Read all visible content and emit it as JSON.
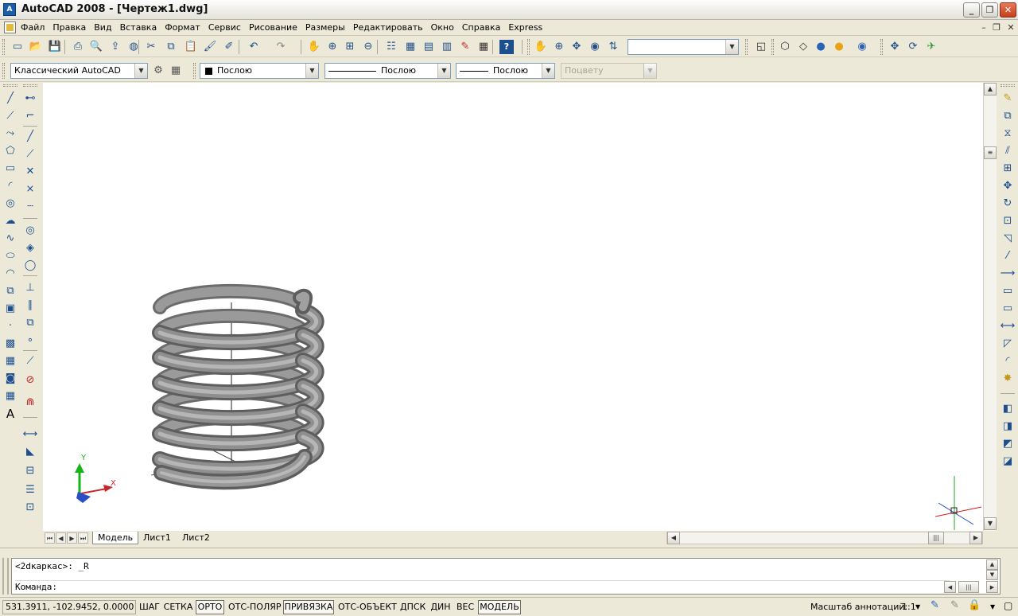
{
  "window": {
    "title": "AutoCAD 2008 - [Чертеж1.dwg]",
    "app_icon_text": "A",
    "minimize_symbol": "_",
    "restore_symbol": "❐",
    "close_symbol": "✕"
  },
  "menu": {
    "items": [
      "Файл",
      "Правка",
      "Вид",
      "Вставка",
      "Формат",
      "Сервис",
      "Рисование",
      "Размеры",
      "Редактировать",
      "Окно",
      "Справка",
      "Express"
    ],
    "doc_minimize": "–",
    "doc_restore": "❐",
    "doc_close": "✕"
  },
  "standard_toolbar": {
    "icons": [
      "new-icon",
      "open-icon",
      "save-icon",
      "plot-icon",
      "plot-preview-icon",
      "publish-icon",
      "3d-dwf-icon",
      "cut-icon",
      "copy-icon",
      "paste-icon",
      "match-properties-icon",
      "block-editor-icon",
      "undo-icon",
      "redo-icon",
      "pan-icon",
      "zoom-realtime-icon",
      "zoom-window-icon",
      "zoom-previous-icon",
      "properties-icon",
      "design-center-icon",
      "tool-palettes-icon",
      "sheet-set-icon",
      "markup-icon",
      "calculator-icon",
      "help-icon"
    ],
    "view_combo_value": ""
  },
  "styles_toolbar": {
    "workspace": "Классический AutoCAD",
    "color": "Послою",
    "linetype": "Послою",
    "lineweight": "Послою",
    "plot_style": "Поцвету"
  },
  "draw_toolbar_icons": [
    "line-icon",
    "construction-line-icon",
    "polyline-icon",
    "polygon-icon",
    "rectangle-icon",
    "arc-icon",
    "circle-icon",
    "revision-cloud-icon",
    "spline-icon",
    "ellipse-icon",
    "ellipse-arc-icon",
    "insert-block-icon",
    "make-block-icon",
    "point-icon",
    "hatch-icon",
    "gradient-icon",
    "region-icon",
    "table-icon",
    "multiline-text-icon"
  ],
  "osnap_toolbar_icons": [
    "temp-track-icon",
    "snap-from-icon",
    "endpoint-icon",
    "midpoint-icon",
    "intersection-icon",
    "apparent-intersection-icon",
    "extension-icon",
    "center-icon",
    "quadrant-icon",
    "tangent-icon",
    "perpendicular-icon",
    "parallel-icon",
    "insert-point-icon",
    "node-icon",
    "nearest-icon",
    "snap-none-icon",
    "osnap-settings-icon",
    "dimension-linear-icon",
    "dimension-aligned-icon",
    "dimension-ordinate-icon",
    "dimension-radius-icon",
    "dimension-diameter-icon"
  ],
  "modify_toolbar_icons": [
    "erase-icon",
    "copy-object-icon",
    "mirror-icon",
    "offset-icon",
    "array-icon",
    "move-icon",
    "rotate-icon",
    "scale-icon",
    "stretch-icon",
    "trim-icon",
    "extend-icon",
    "break-at-point-icon",
    "break-icon",
    "join-icon",
    "chamfer-icon",
    "fillet-icon",
    "explode-icon",
    "draworder-front-icon",
    "draworder-back-icon",
    "draworder-above-icon",
    "draworder-under-icon"
  ],
  "ucs": {
    "y_label": "Y",
    "x_label": "X"
  },
  "layout_tabs": [
    "Модель",
    "Лист1",
    "Лист2"
  ],
  "command": {
    "history": "<2dкаркас>: _R",
    "prompt": "Команда:"
  },
  "status": {
    "coordinates": "531.3911, -102.9452, 0.0000",
    "buttons": [
      {
        "label": "ШАГ",
        "on": false
      },
      {
        "label": "СЕТКА",
        "on": false
      },
      {
        "label": "ОРТО",
        "on": true
      },
      {
        "label": "ОТС-ПОЛЯР",
        "on": false
      },
      {
        "label": "ПРИВЯЗКА",
        "on": true
      },
      {
        "label": "ОТС-ОБЪЕКТ",
        "on": false
      },
      {
        "label": "ДПСК",
        "on": false
      },
      {
        "label": "ДИН",
        "on": false
      },
      {
        "label": "ВЕС",
        "on": false
      },
      {
        "label": "МОДЕЛЬ",
        "on": true
      }
    ],
    "annotation_scale_label": "Масштаб аннотаций:",
    "annotation_scale_value": "1:1"
  },
  "colors": {
    "canvas": "#ffffff",
    "spring": "#8e8e8e",
    "ucs_x": "#e02b2b",
    "ucs_y": "#17b417",
    "ucs_z": "#2a4ec8",
    "cursor_green": "#1ea81e",
    "cursor_red": "#d21e1e"
  }
}
